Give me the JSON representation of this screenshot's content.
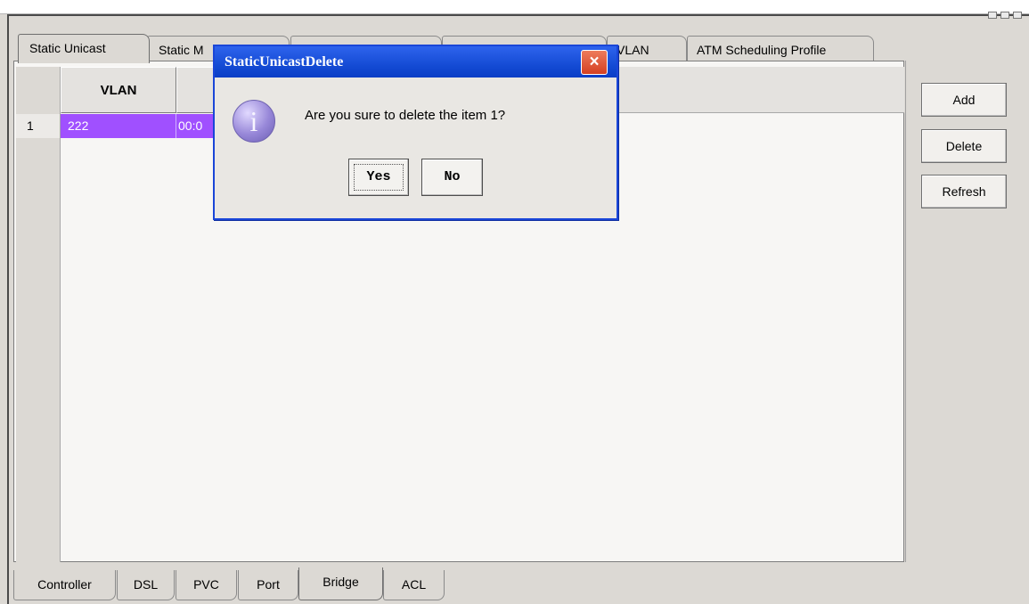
{
  "top_tabs": [
    {
      "label": "Static Unicast",
      "active": true
    },
    {
      "label": "Static M",
      "active": false
    },
    {
      "label": "",
      "active": false
    },
    {
      "label": "",
      "active": false
    },
    {
      "label": "VLAN",
      "active": false
    },
    {
      "label": "ATM Scheduling Profile",
      "active": false
    }
  ],
  "table": {
    "columns": [
      "VLAN",
      ""
    ],
    "rows": [
      {
        "num": "1",
        "vlan": "222",
        "mac": "00:0"
      }
    ]
  },
  "side_buttons": {
    "add": "Add",
    "delete": "Delete",
    "refresh": "Refresh"
  },
  "dialog": {
    "title": "StaticUnicastDelete",
    "close": "×",
    "icon": "i",
    "message": "Are you sure to delete the item 1?",
    "yes_label": "Yes",
    "no_label": "No"
  },
  "bottom_tabs": [
    {
      "label": "Controller",
      "active": false
    },
    {
      "label": "DSL",
      "active": false
    },
    {
      "label": "PVC",
      "active": false
    },
    {
      "label": "Port",
      "active": false
    },
    {
      "label": "Bridge",
      "active": true
    },
    {
      "label": "ACL",
      "active": false
    }
  ],
  "colors": {
    "selected_row": "#a050ff",
    "dialog_title": "#134ad3",
    "close_button": "#d54022"
  }
}
